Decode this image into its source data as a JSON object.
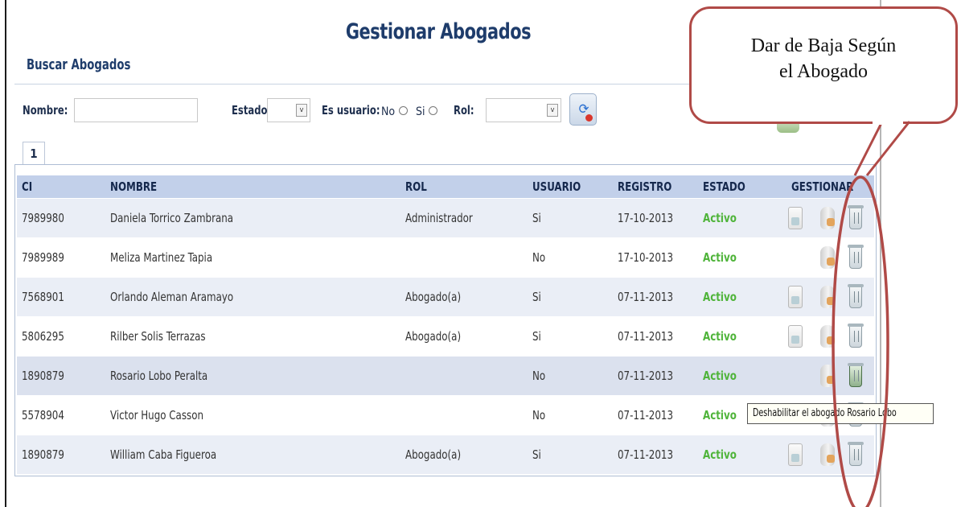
{
  "page": {
    "title": "Gestionar Abogados",
    "section": "Buscar Abogados"
  },
  "filters": {
    "nombre_label": "Nombre:",
    "nombre_value": "",
    "estado_label": "Estado:",
    "estado_value": "",
    "usuario_label": "Es usuario:",
    "usuario_no": "No",
    "usuario_si": "Si",
    "rol_label": "Rol:",
    "rol_value": ""
  },
  "pagination": {
    "current": "1"
  },
  "table": {
    "headers": [
      "CI",
      "NOMBRE",
      "ROL",
      "USUARIO",
      "REGISTRO",
      "ESTADO",
      "GESTIONAR"
    ],
    "rows": [
      {
        "ci": "7989980",
        "nombre": "Daniela Torrico Zambrana",
        "rol": "Administrador",
        "usuario": "Si",
        "registro": "17-10-2013",
        "estado": "Activo"
      },
      {
        "ci": "7989989",
        "nombre": "Meliza Martinez Tapia",
        "rol": "",
        "usuario": "No",
        "registro": "17-10-2013",
        "estado": "Activo"
      },
      {
        "ci": "7568901",
        "nombre": "Orlando Aleman Aramayo",
        "rol": "Abogado(a)",
        "usuario": "Si",
        "registro": "07-11-2013",
        "estado": "Activo"
      },
      {
        "ci": "5806295",
        "nombre": "Rilber Solis Terrazas",
        "rol": "Abogado(a)",
        "usuario": "Si",
        "registro": "07-11-2013",
        "estado": "Activo"
      },
      {
        "ci": "1890879",
        "nombre": "Rosario Lobo Peralta",
        "rol": "",
        "usuario": "No",
        "registro": "07-11-2013",
        "estado": "Activo"
      },
      {
        "ci": "5578904",
        "nombre": "Victor Hugo Casson",
        "rol": "",
        "usuario": "No",
        "registro": "07-11-2013",
        "estado": "Activo"
      },
      {
        "ci": "1890879",
        "nombre": "William Caba Figueroa",
        "rol": "Abogado(a)",
        "usuario": "Si",
        "registro": "07-11-2013",
        "estado": "Activo"
      }
    ]
  },
  "tooltip": "Deshabilitar el abogado Rosario Lobo",
  "callout": {
    "line1": "Dar de Baja Según",
    "line2": "el Abogado"
  },
  "colors": {
    "header_bg": "#c2d0ea",
    "active_status": "#4fb43a",
    "callout_border": "#b04a47",
    "title": "#1e3c6b"
  }
}
